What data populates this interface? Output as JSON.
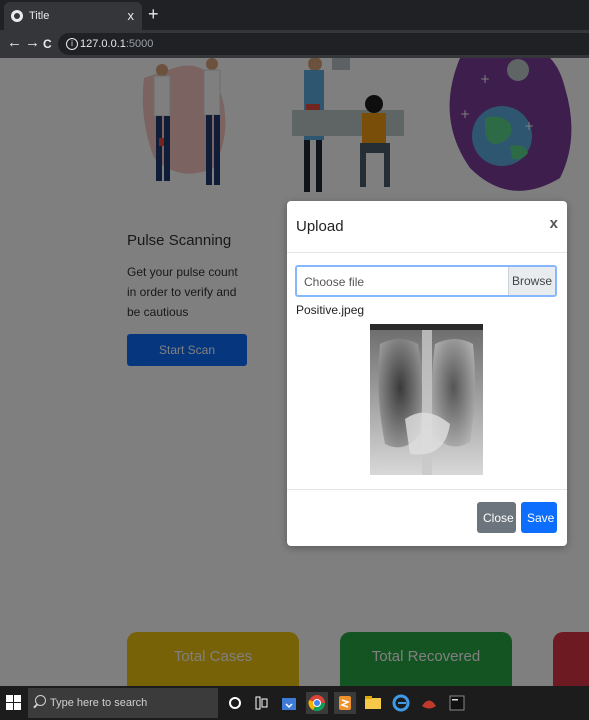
{
  "browser": {
    "tab_title": "Title",
    "tab_close": "x",
    "new_tab": "+",
    "url_host": "127.0.0.1",
    "url_port": ":5000",
    "back": "←",
    "forward": "→",
    "reload": "C",
    "info": "i"
  },
  "page": {
    "pulse_title": "Pulse Scanning",
    "pulse_desc": "Get your pulse count in order to verify and be cautious",
    "start_button": "Start Scan",
    "cards": [
      "Total Cases",
      "Total Recovered"
    ]
  },
  "modal": {
    "title": "Upload",
    "close_x": "x",
    "file_placeholder": "Choose file",
    "browse_label": "Browse",
    "file_name": "Positive.jpeg",
    "close_button": "Close",
    "save_button": "Save"
  },
  "taskbar": {
    "search_placeholder": "Type here to search",
    "icons": [
      "windows-start-icon",
      "cortana-icon",
      "task-view-icon",
      "downloads-icon",
      "chrome-icon",
      "sublime-text-icon",
      "file-explorer-icon",
      "edge-icon",
      "game-icon",
      "terminal-icon"
    ]
  },
  "colors": {
    "primary": "#0d6efd",
    "secondary": "#6c757d",
    "cases": "#f1c40f",
    "recovered": "#28a745",
    "third_card": "#dc3545"
  }
}
